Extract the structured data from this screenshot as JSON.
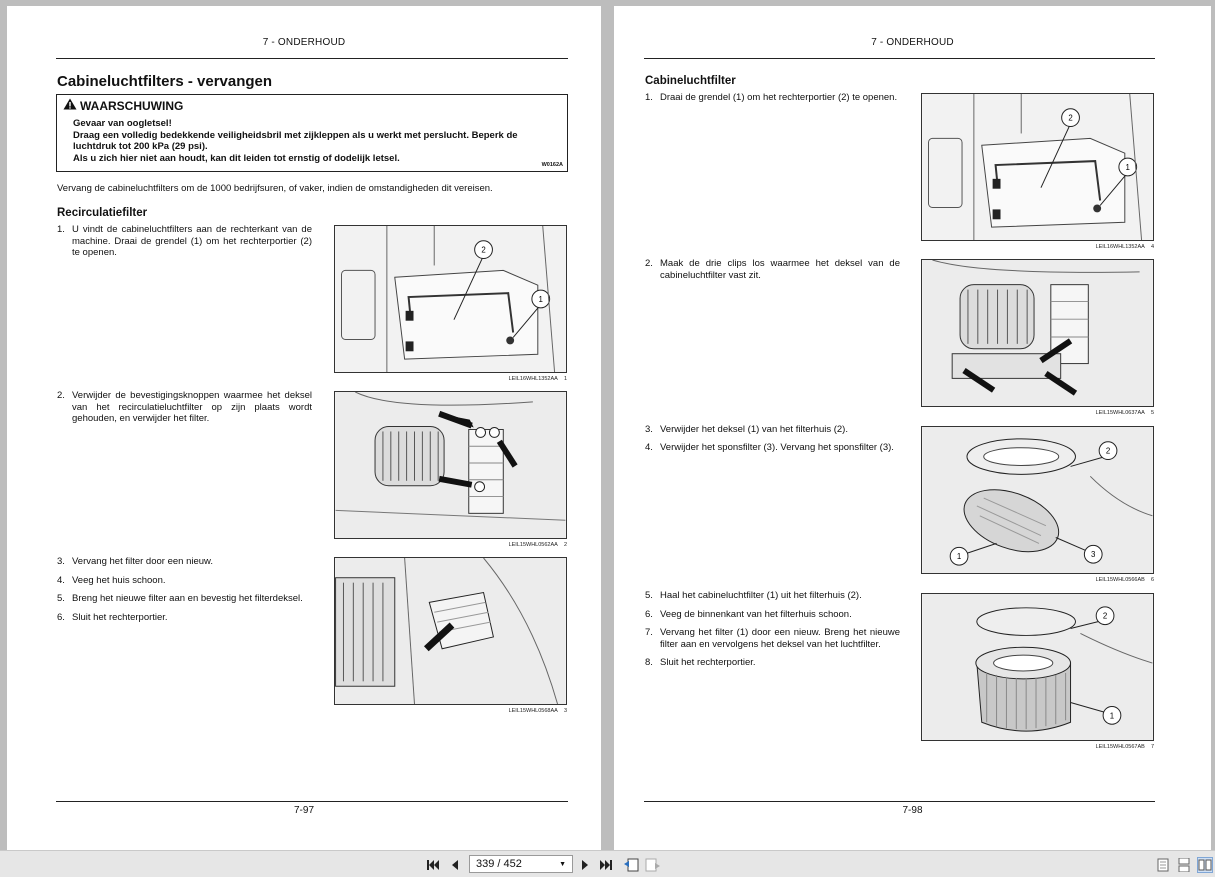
{
  "left_page": {
    "header": "7 - ONDERHOUD",
    "title": "Cabineluchtfilters - vervangen",
    "warning": {
      "title": "WAARSCHUWING",
      "lines": [
        "Gevaar van oogletsel!",
        "Draag een volledig bedekkende veiligheidsbril met zijkleppen als u werkt met perslucht.  Beperk de luchtdruk tot 200 kPa (29 psi).",
        "Als u zich hier niet aan houdt, kan dit leiden tot ernstig of dodelijk letsel."
      ],
      "code": "W0162A"
    },
    "intro": "Vervang de cabineluchtfilters om de 1000 bedrijfsuren, of vaker, indien de omstandigheden dit vereisen.",
    "section": "Recirculatiefilter",
    "steps": [
      {
        "num": "1.",
        "text": "U vindt de cabineluchtfilters aan de rechterkant van de machine.  Draai de grendel (1) om het rechterportier (2) te openen."
      },
      {
        "num": "2.",
        "text": "Verwijder de bevestigingsknoppen waarmee het deksel van het recirculatieluchtfilter op zijn plaats wordt gehouden, en verwijder het filter."
      },
      {
        "num": "3.",
        "text": "Vervang het filter door een nieuw."
      },
      {
        "num": "4.",
        "text": "Veeg het huis schoon."
      },
      {
        "num": "5.",
        "text": "Breng het nieuwe filter aan en bevestig het filterdeksel."
      },
      {
        "num": "6.",
        "text": "Sluit het rechterportier."
      }
    ],
    "figures": [
      {
        "code": "LEIL16WHL1352AA",
        "num": "1"
      },
      {
        "code": "LEIL15WHL0562AA",
        "num": "2"
      },
      {
        "code": "LEIL15WHL0568AA",
        "num": "3"
      }
    ],
    "footer": "7-97"
  },
  "right_page": {
    "header": "7 - ONDERHOUD",
    "section": "Cabineluchtfilter",
    "steps": [
      {
        "num": "1.",
        "text": "Draai de grendel (1) om het rechterportier (2) te openen."
      },
      {
        "num": "2.",
        "text": "Maak de drie clips los waarmee het deksel van de cabineluchtfilter vast zit."
      },
      {
        "num": "3.",
        "text": "Verwijder het deksel (1) van het filterhuis (2)."
      },
      {
        "num": "4.",
        "text": "Verwijder het sponsfilter (3).  Vervang het sponsfilter (3)."
      },
      {
        "num": "5.",
        "text": "Haal het cabineluchtfilter (1) uit het filterhuis (2)."
      },
      {
        "num": "6.",
        "text": "Veeg de binnenkant van het filterhuis schoon."
      },
      {
        "num": "7.",
        "text": "Vervang het filter (1) door een nieuw. Breng het nieuwe filter aan en vervolgens het deksel van het luchtfilter."
      },
      {
        "num": "8.",
        "text": "Sluit het rechterportier."
      }
    ],
    "figures": [
      {
        "code": "LEIL16WHL1352AA",
        "num": "4"
      },
      {
        "code": "LEIL15WHL0637AA",
        "num": "5"
      },
      {
        "code": "LEIL15WHL0566AB",
        "num": "6"
      },
      {
        "code": "LEIL15WHL0567AB",
        "num": "7"
      }
    ],
    "footer": "7-98"
  },
  "toolbar": {
    "page_indicator": "339 / 452",
    "icons": [
      "first-page-icon",
      "prev-page-icon",
      "next-page-icon",
      "last-page-icon",
      "back-icon",
      "forward-icon",
      "single-page-icon",
      "continuous-icon",
      "two-page-icon"
    ]
  },
  "colors": {
    "background": "#bdbdbd",
    "page": "#ffffff",
    "toolbar": "#e6e6e6",
    "text": "#111111"
  }
}
